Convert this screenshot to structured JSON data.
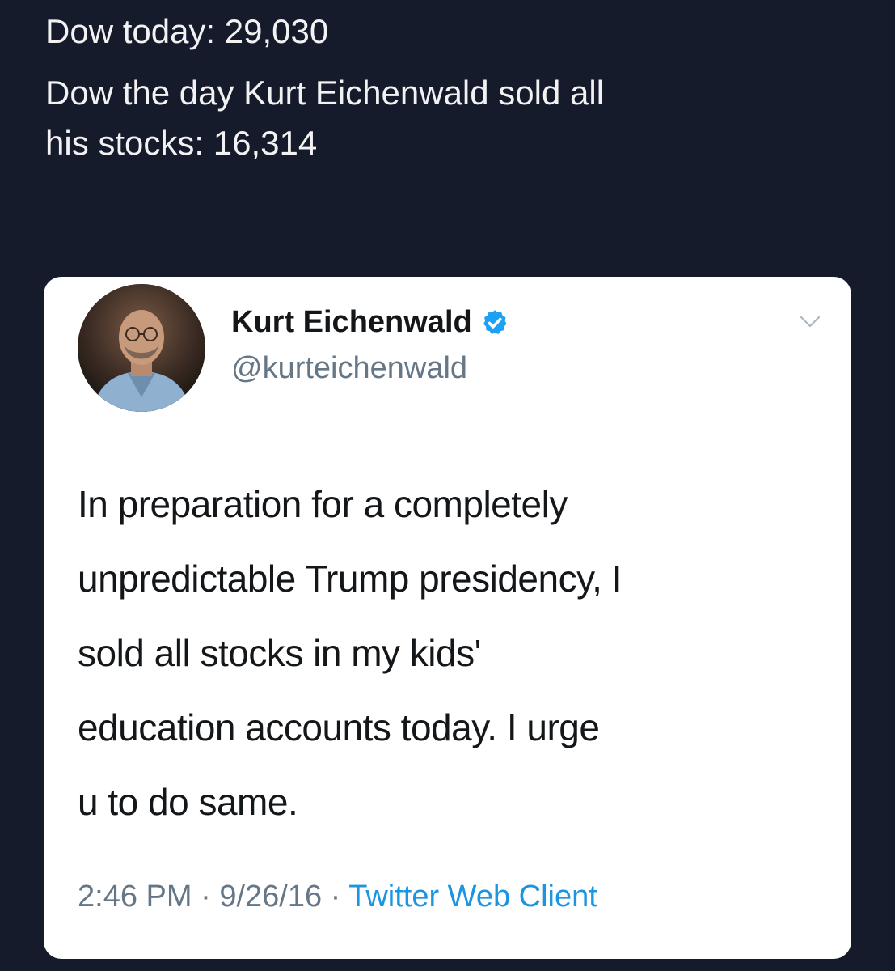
{
  "caption": {
    "line1": "Dow today: 29,030",
    "line2": "Dow the day Kurt Eichenwald sold all",
    "line3": "his stocks: 16,314"
  },
  "tweet": {
    "display_name": "Kurt Eichenwald",
    "handle": "@kurteichenwald",
    "verified_icon": "verified-badge-icon",
    "menu_icon": "chevron-down-icon",
    "text_lines": [
      "In preparation for a completely",
      "unpredictable Trump presidency, I",
      "sold all stocks in my kids'",
      "education accounts today. I urge",
      "u to do same."
    ],
    "time": "2:46 PM",
    "separator": " · ",
    "date": "9/26/16",
    "client": "Twitter Web Client"
  },
  "colors": {
    "background": "#161b2b",
    "card": "#ffffff",
    "verified": "#1da1f2",
    "link": "#1b95e0",
    "secondary_text": "#657786"
  }
}
